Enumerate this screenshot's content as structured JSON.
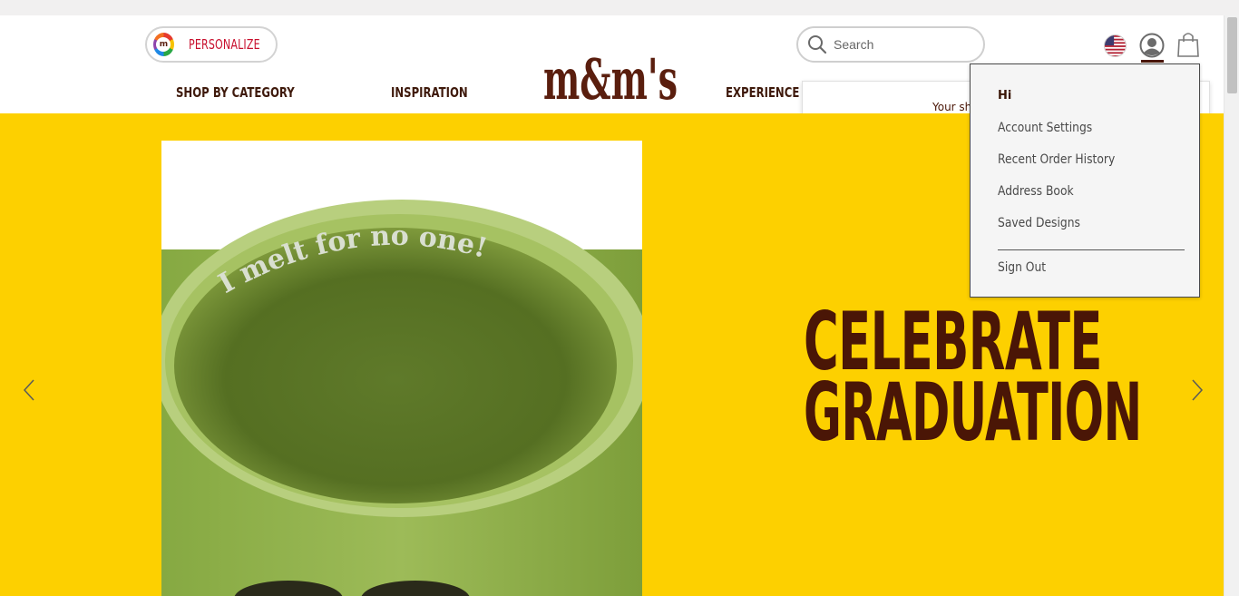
{
  "header": {
    "personalize_label": "PERSONALIZE",
    "badge_letter": "m",
    "nav": [
      "SHOP BY CATEGORY",
      "INSPIRATION",
      "EXPERIENCE M&M'S"
    ],
    "logo_text": "m&m's",
    "search_placeholder": "Search",
    "cart_popup_text": "Your shopping bag is empty"
  },
  "account_menu": {
    "greeting": "Hi",
    "items": [
      "Account Settings",
      "Recent Order History",
      "Address Book",
      "Saved Designs"
    ],
    "sign_out": "Sign Out"
  },
  "hero": {
    "mug_text": "I melt for no one!",
    "headline_line1": "CELEBRATE",
    "headline_line2": "GRADUATION"
  },
  "colors": {
    "brand_brown": "#4a1606",
    "hero_yellow": "#fdd000",
    "personalize_red": "#c8102e"
  }
}
